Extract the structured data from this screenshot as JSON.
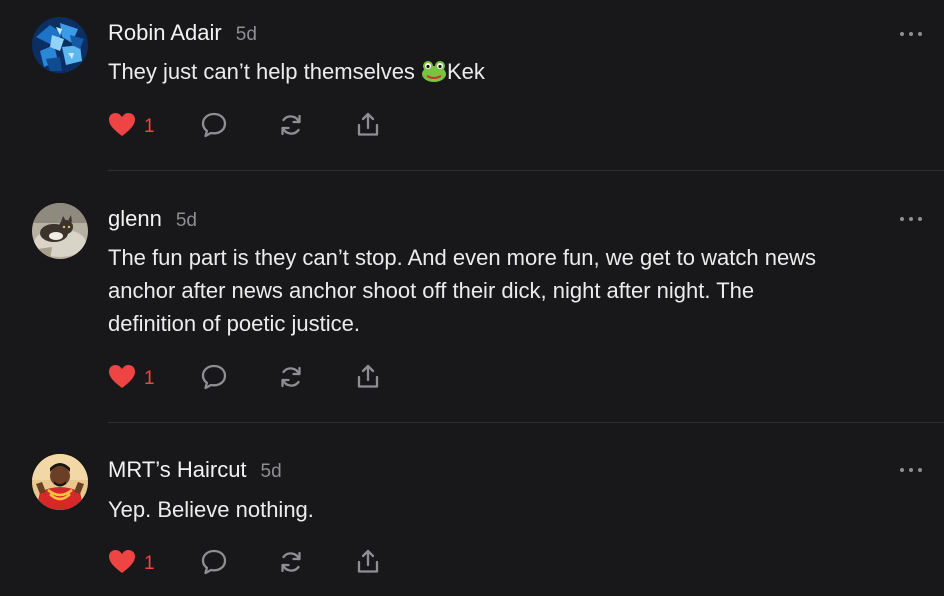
{
  "comments": [
    {
      "author": "Robin Adair",
      "time": "5d",
      "lines": [
        "They just can’t help themselves",
        "Kek"
      ],
      "likes": "1",
      "avatar_icon": "blue-abstract-avatar"
    },
    {
      "author": "glenn",
      "time": "5d",
      "lines": [
        "The fun part is they can’t stop. And even more fun, we get to watch news",
        "anchor after news anchor shoot off their dick, night after night. The",
        "definition of poetic justice."
      ],
      "likes": "1",
      "avatar_icon": "cat-photo-avatar"
    },
    {
      "author": "MRT’s Haircut",
      "time": "5d",
      "lines": [
        "Yep. Believe nothing."
      ],
      "likes": "1",
      "avatar_icon": "person-red-avatar"
    }
  ],
  "icons": {
    "like": "heart-icon",
    "reply": "speech-bubble-icon",
    "repost": "repost-arrows-icon",
    "share": "share-upload-icon",
    "more": "more-dots-icon",
    "emoji": "frog-emoji-icon"
  },
  "colors": {
    "background": "#18181a",
    "text": "#ececec",
    "muted": "#8e8e93",
    "like": "#ef4444",
    "divider": "#2e2e31"
  }
}
